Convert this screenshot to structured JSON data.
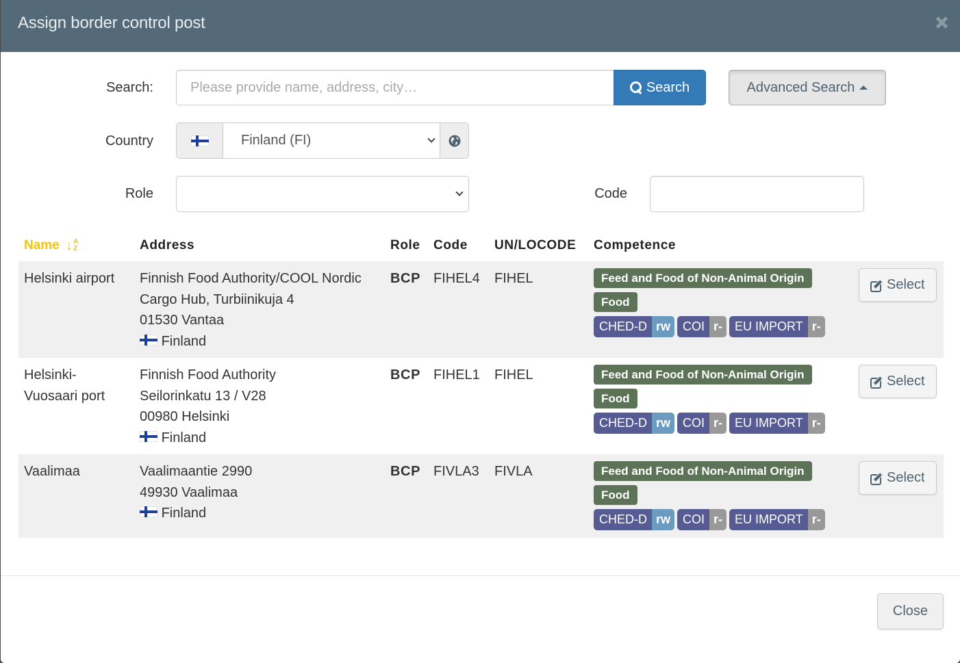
{
  "dialog": {
    "title": "Assign border control post",
    "close_icon": "close-icon"
  },
  "form": {
    "search_label": "Search:",
    "search_placeholder": "Please provide name, address, city…",
    "search_value": "",
    "search_button": "Search",
    "advanced_search_button": "Advanced Search",
    "country_label": "Country",
    "country_value": "Finland (FI)",
    "role_label": "Role",
    "role_value": "",
    "code_label": "Code",
    "code_value": ""
  },
  "table": {
    "headers": {
      "name": "Name",
      "address": "Address",
      "role": "Role",
      "code": "Code",
      "unlocode": "UN/LOCODE",
      "competence": "Competence"
    },
    "sort_icon": "sort-alpha-asc-icon",
    "sort_letters": [
      "A",
      "Z"
    ],
    "rows": [
      {
        "name": "Helsinki airport",
        "address_lines": [
          "Finnish Food Authority/COOL Nordic",
          "Cargo Hub, Turbiinikuja 4",
          "01530 Vantaa"
        ],
        "country": "Finland",
        "role": "BCP",
        "code": "FIHEL4",
        "unlocode": "FIHEL",
        "categories": [
          "Feed and Food of Non-Animal Origin",
          "Food"
        ],
        "permissions": [
          {
            "name": "CHED-D",
            "access": "rw"
          },
          {
            "name": "COI",
            "access": "r-"
          },
          {
            "name": "EU IMPORT",
            "access": "r-"
          }
        ],
        "select_label": "Select"
      },
      {
        "name": "Helsinki-Vuosaari port",
        "address_lines": [
          "Finnish Food Authority",
          "Seilorinkatu 13 / V28",
          "00980 Helsinki"
        ],
        "country": "Finland",
        "role": "BCP",
        "code": "FIHEL1",
        "unlocode": "FIHEL",
        "categories": [
          "Feed and Food of Non-Animal Origin",
          "Food"
        ],
        "permissions": [
          {
            "name": "CHED-D",
            "access": "rw"
          },
          {
            "name": "COI",
            "access": "r-"
          },
          {
            "name": "EU IMPORT",
            "access": "r-"
          }
        ],
        "select_label": "Select"
      },
      {
        "name": "Vaalimaa",
        "address_lines": [
          "Vaalimaantie 2990",
          "49930 Vaalimaa"
        ],
        "country": "Finland",
        "role": "BCP",
        "code": "FIVLA3",
        "unlocode": "FIVLA",
        "categories": [
          "Feed and Food of Non-Animal Origin",
          "Food"
        ],
        "permissions": [
          {
            "name": "CHED-D",
            "access": "rw"
          },
          {
            "name": "COI",
            "access": "r-"
          },
          {
            "name": "EU IMPORT",
            "access": "r-"
          }
        ],
        "select_label": "Select"
      }
    ]
  },
  "footer": {
    "close_button": "Close"
  },
  "colors": {
    "header_bg": "#546a78",
    "primary": "#337ab7",
    "sorted_header": "#f1c40f",
    "category_badge": "#5d7358",
    "permission_badge": "#565b94",
    "rw_badge": "#6b9cbf",
    "r_badge": "#999999"
  }
}
